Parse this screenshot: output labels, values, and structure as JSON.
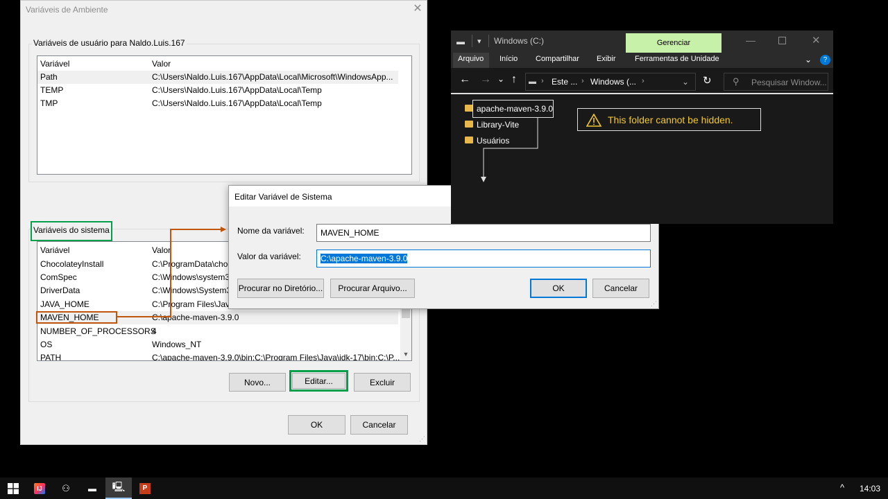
{
  "env_window": {
    "title": "Variáveis de Ambiente",
    "user_group_label": "Variáveis de usuário para Naldo.Luis.167",
    "user_headers": [
      "Variável",
      "Valor"
    ],
    "user_vars": [
      {
        "name": "Path",
        "value": "C:\\Users\\Naldo.Luis.167\\AppData\\Local\\Microsoft\\WindowsApp..."
      },
      {
        "name": "TEMP",
        "value": "C:\\Users\\Naldo.Luis.167\\AppData\\Local\\Temp"
      },
      {
        "name": "TMP",
        "value": "C:\\Users\\Naldo.Luis.167\\AppData\\Local\\Temp"
      }
    ],
    "system_group_label": "Variáveis do sistema",
    "system_headers": [
      "Variável",
      "Valor"
    ],
    "system_vars": [
      {
        "name": "ChocolateyInstall",
        "value": "C:\\ProgramData\\choc"
      },
      {
        "name": "ComSpec",
        "value": "C:\\Windows\\system3"
      },
      {
        "name": "DriverData",
        "value": "C:\\Windows\\System3"
      },
      {
        "name": "JAVA_HOME",
        "value": "C:\\Program Files\\Java"
      },
      {
        "name": "MAVEN_HOME",
        "value": "C:\\apache-maven-3.9.0"
      },
      {
        "name": "NUMBER_OF_PROCESSORS",
        "value": "4"
      },
      {
        "name": "OS",
        "value": "Windows_NT"
      },
      {
        "name": "PATH",
        "value": "C:\\apache-maven-3.9.0\\bin;C:\\Program Files\\Java\\jdk-17\\bin;C:\\P..."
      }
    ],
    "btn_new": "Novo...",
    "btn_edit": "Editar...",
    "btn_delete": "Excluir",
    "btn_ok": "OK",
    "btn_cancel": "Cancelar"
  },
  "edit_dialog": {
    "title": "Editar Variável de Sistema",
    "name_label": "Nome da variável:",
    "name_value": "MAVEN_HOME",
    "value_label": "Valor da variável:",
    "value_value": "C:\\apache-maven-3.9.0",
    "btn_browse_dir": "Procurar no Diretório...",
    "btn_browse_file": "Procurar Arquivo...",
    "btn_ok": "OK",
    "btn_cancel": "Cancelar"
  },
  "explorer": {
    "title": "Windows (C:)",
    "manage_tab": "Gerenciar",
    "ribbon_tabs": [
      "Arquivo",
      "Início",
      "Compartilhar",
      "Exibir",
      "Ferramentas de Unidade"
    ],
    "breadcrumb": [
      "Este ...",
      "Windows (..."
    ],
    "search_placeholder": "Pesquisar Window...",
    "folders": [
      "apache-maven-3.9.0",
      "Library-Vite",
      "Usuários"
    ],
    "warning": "This folder cannot be hidden."
  },
  "taskbar": {
    "clock": "14:03"
  },
  "colors": {
    "highlight_green": "#00a04a",
    "connector_orange": "#c0560c",
    "selection_blue": "#0078d7",
    "manage_tab_bg": "#c7f0a8",
    "warning_text": "#f3c830"
  }
}
